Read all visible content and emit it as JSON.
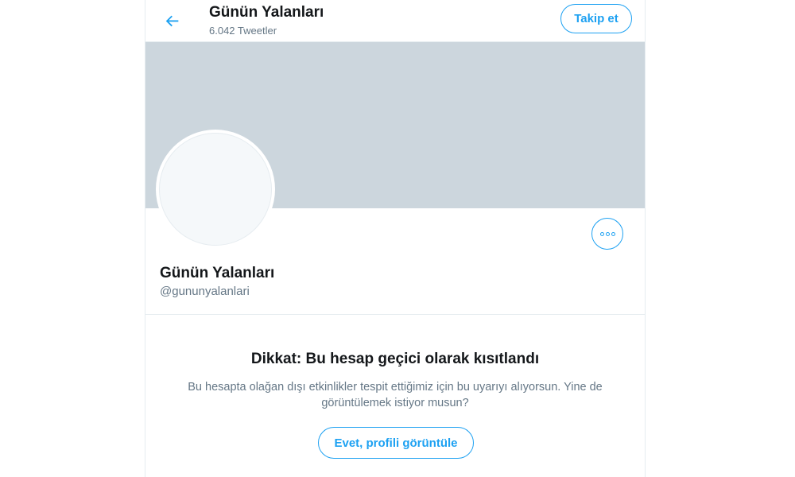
{
  "header": {
    "title": "Günün Yalanları",
    "tweet_count": "6.042 Tweetler",
    "back_icon": "arrow-left-icon",
    "follow_label": "Takip et"
  },
  "profile": {
    "display_name": "Günün Yalanları",
    "handle": "@gununyalanlari",
    "more_icon": "more-options-icon"
  },
  "warning": {
    "title": "Dikkat: Bu hesap geçici olarak kısıtlandı",
    "message": "Bu hesapta olağan dışı etkinlikler tespit ettiğimiz için bu uyarıyı alıyorsun. Yine de görüntülemek istiyor musun?",
    "button_label": "Evet, profili görüntüle"
  },
  "colors": {
    "accent": "#1da1f2",
    "banner": "#ccd6dd",
    "secondary_text": "#657786",
    "primary_text": "#14171a",
    "border": "#e6ecf0"
  }
}
